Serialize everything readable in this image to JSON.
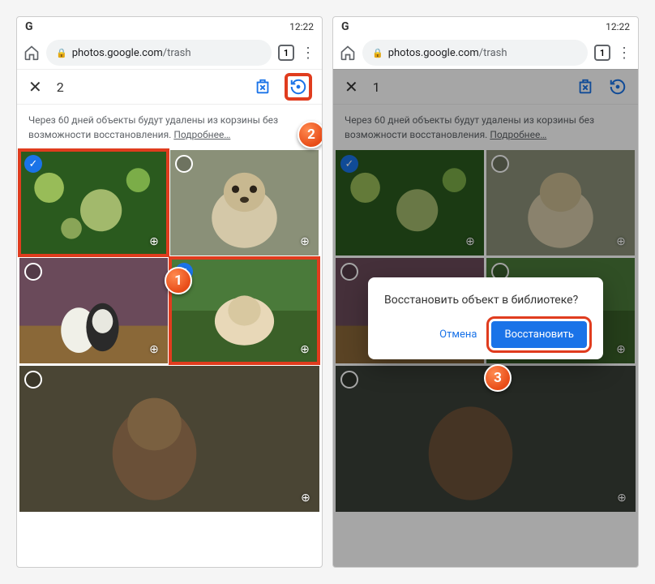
{
  "status": {
    "logo": "G",
    "time": "12:22"
  },
  "browser": {
    "url_domain": "photos.google.com",
    "url_path": "/trash",
    "tab_count": "1"
  },
  "left": {
    "selected_count": "2",
    "info_text": "Через 60 дней объекты будут удалены из корзины без возможности восстановления. ",
    "info_link": "Подробнее…"
  },
  "right": {
    "selected_count": "1",
    "info_text": "Через 60 дней объекты будут удалены из корзины без возможности восстановления. ",
    "info_link": "Подробнее…"
  },
  "dialog": {
    "message": "Восстановить объект в библиотеке?",
    "cancel": "Отмена",
    "confirm": "Восстановить"
  },
  "steps": {
    "s1": "1",
    "s2": "2",
    "s3": "3"
  }
}
